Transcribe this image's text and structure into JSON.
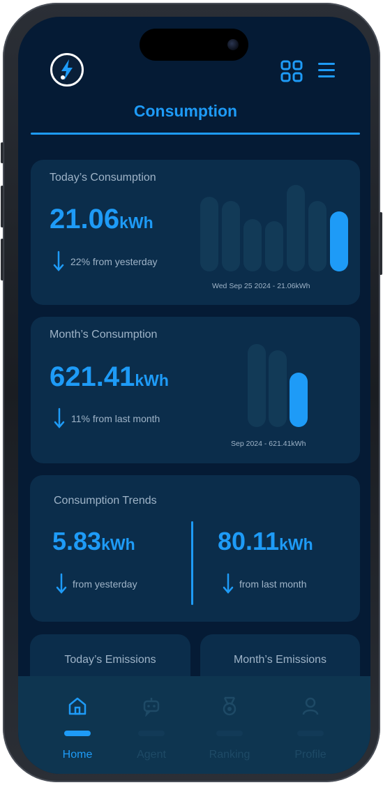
{
  "colors": {
    "accent": "#1e9bf7",
    "background": "#051b35",
    "card": "#0b2d4b",
    "bar_inactive": "#123a57",
    "muted_text": "#9fb4c8",
    "nav_background": "#0e3550"
  },
  "header": {
    "logo_icon": "lightning-bolt-icon",
    "grid_icon": "grid-icon",
    "menu_icon": "hamburger-menu-icon",
    "title": "Consumption"
  },
  "today": {
    "label": "Today’s Consumption",
    "value": "21.06",
    "unit": "kWh",
    "change_text": "22% from yesterday",
    "change_icon": "arrow-down-icon",
    "caption": "Wed Sep 25 2024 - 21.06kWh",
    "bars": [
      {
        "level": 0.82,
        "active": false
      },
      {
        "level": 0.78,
        "active": false
      },
      {
        "level": 0.58,
        "active": false
      },
      {
        "level": 0.55,
        "active": false
      },
      {
        "level": 0.95,
        "active": false
      },
      {
        "level": 0.78,
        "active": false
      },
      {
        "level": 0.66,
        "active": true
      }
    ]
  },
  "month": {
    "label": "Month’s Consumption",
    "value": "621.41",
    "unit": "kWh",
    "change_text": "11% from last month",
    "change_icon": "arrow-down-icon",
    "caption": "Sep 2024 - 621.41kWh",
    "bars": [
      {
        "level": 0.95,
        "active": false
      },
      {
        "level": 0.88,
        "active": false
      },
      {
        "level": 0.62,
        "active": true
      }
    ]
  },
  "trends": {
    "label": "Consumption Trends",
    "daily_value": "5.83",
    "daily_unit": "kWh",
    "daily_text": "from yesterday",
    "monthly_value": "80.11",
    "monthly_unit": "kWh",
    "monthly_text": "from last month"
  },
  "emissions": {
    "today_label": "Today’s Emissions",
    "month_label": "Month’s Emissions"
  },
  "nav": {
    "items": [
      {
        "label": "Home",
        "icon": "home-icon",
        "active": true
      },
      {
        "label": "Agent",
        "icon": "robot-icon",
        "active": false
      },
      {
        "label": "Ranking",
        "icon": "medal-icon",
        "active": false
      },
      {
        "label": "Profile",
        "icon": "user-icon",
        "active": false
      }
    ]
  }
}
